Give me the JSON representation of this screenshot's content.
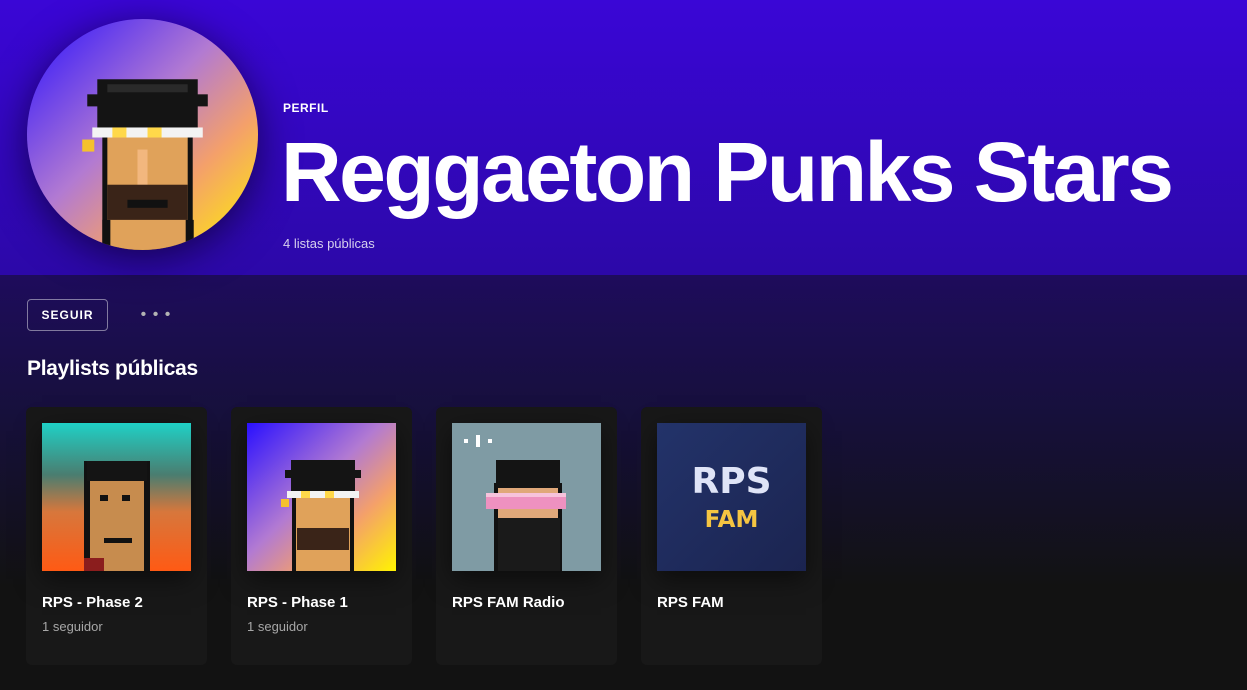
{
  "profile": {
    "kind": "PERFIL",
    "name": "Reggaeton Punks Stars",
    "meta": "4 listas públicas"
  },
  "actions": {
    "follow_label": "SEGUIR",
    "more_label": "• • •"
  },
  "section": {
    "title": "Playlists públicas"
  },
  "playlists": [
    {
      "title": "RPS - Phase 2",
      "subtitle": "1 seguidor"
    },
    {
      "title": "RPS - Phase 1",
      "subtitle": "1 seguidor"
    },
    {
      "title": "RPS FAM Radio",
      "subtitle": ""
    },
    {
      "title": "RPS FAM",
      "subtitle": "",
      "cover_text": [
        "RPS",
        "FAM"
      ]
    }
  ],
  "colors": {
    "hero": "#3a06d6",
    "card": "#181818",
    "accent_yellow": "#f5c542"
  }
}
